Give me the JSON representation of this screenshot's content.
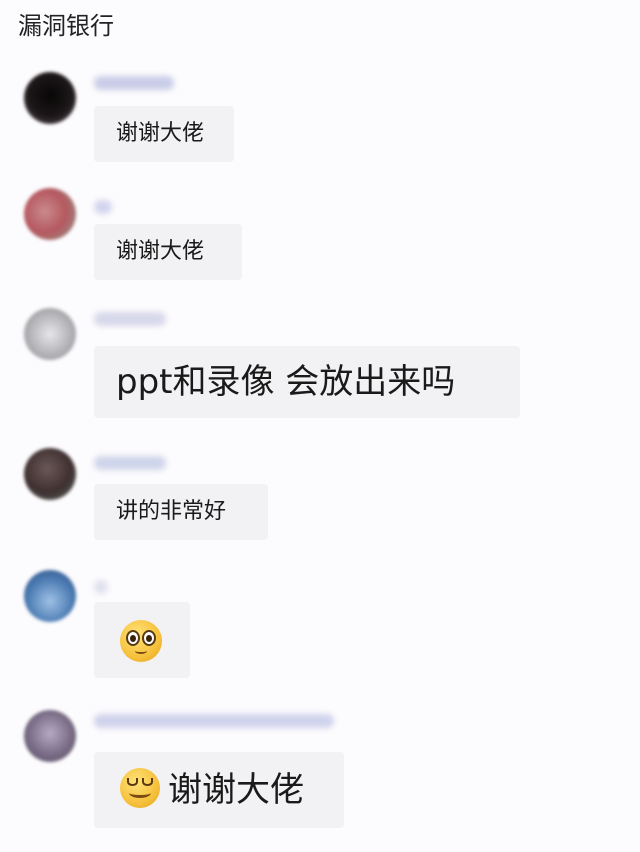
{
  "chat": {
    "title": "漏洞银行"
  },
  "messages": [
    {
      "text": "谢谢大佬",
      "avatar_color": "#1f1b1d",
      "sender_tint": "#c9cde8",
      "emoji": ""
    },
    {
      "text": "谢谢大佬",
      "avatar_color": "#b86a6e",
      "sender_tint": "#d3d5ee",
      "emoji": ""
    },
    {
      "text": "ppt和录像 会放出来吗",
      "avatar_color": "#b8b7bb",
      "sender_tint": "#d7d8ea",
      "emoji": ""
    },
    {
      "text": "讲的非常好",
      "avatar_color": "#4a3c3c",
      "sender_tint": "#cfd5ea",
      "emoji": ""
    },
    {
      "text": "",
      "avatar_color": "#4d7db4",
      "sender_tint": "#dfe1ef",
      "emoji": "pleading-face-icon"
    },
    {
      "text": "谢谢大佬",
      "avatar_color": "#7a6c86",
      "sender_tint": "#d0d3ec",
      "emoji": "grinning-face-icon"
    }
  ]
}
